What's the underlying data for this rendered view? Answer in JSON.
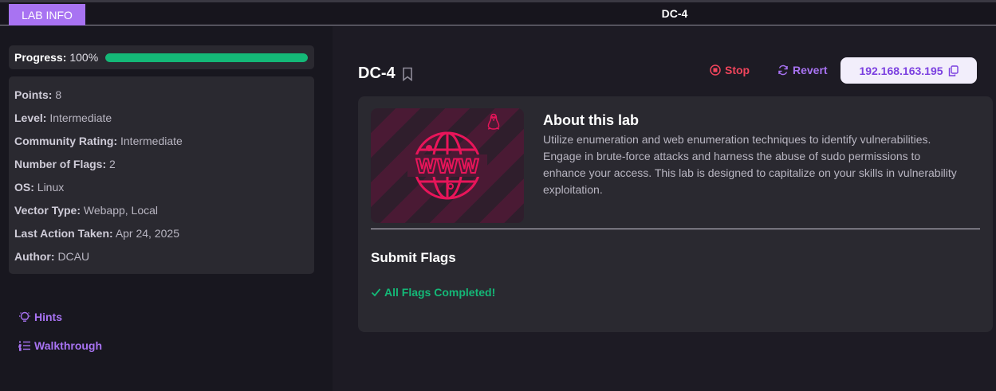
{
  "topbar": {
    "tab_label": "LAB INFO",
    "title": "DC-4"
  },
  "sidebar": {
    "progress": {
      "label": "Progress:",
      "value_text": "100%",
      "fraction": 1.0,
      "color": "#14b877"
    },
    "info": [
      {
        "key": "Points:",
        "value": "8"
      },
      {
        "key": "Level:",
        "value": "Intermediate"
      },
      {
        "key": "Community Rating:",
        "value": "Intermediate"
      },
      {
        "key": "Number of Flags:",
        "value": "2"
      },
      {
        "key": "OS:",
        "value": "Linux"
      },
      {
        "key": "Vector Type:",
        "value": "Webapp, Local"
      },
      {
        "key": "Last Action Taken:",
        "value": "Apr 24, 2025"
      },
      {
        "key": "Author:",
        "value": "DCAU"
      }
    ],
    "links": {
      "hints": "Hints",
      "walkthrough": "Walkthrough"
    }
  },
  "main": {
    "lab_title": "DC-4",
    "actions": {
      "stop": "Stop",
      "revert": "Revert",
      "ip": "192.168.163.195"
    },
    "about": {
      "title": "About this lab",
      "text": "Utilize enumeration and web enumeration techniques to identify vulnerabilities. Engage in brute-force attacks and harness the abuse of sudo permissions to enhance your access. This lab is designed to capitalize on your skills in vulnerability exploitation."
    },
    "banner": {
      "icon": "www-globe-icon",
      "os_icon": "linux-penguin-icon",
      "word": "WWW"
    },
    "submit": {
      "title": "Submit Flags",
      "status": "All Flags Completed!"
    }
  },
  "colors": {
    "accent": "#a873f2",
    "danger": "#f0455c",
    "success": "#14b877",
    "banner_pink": "#e8155a"
  }
}
